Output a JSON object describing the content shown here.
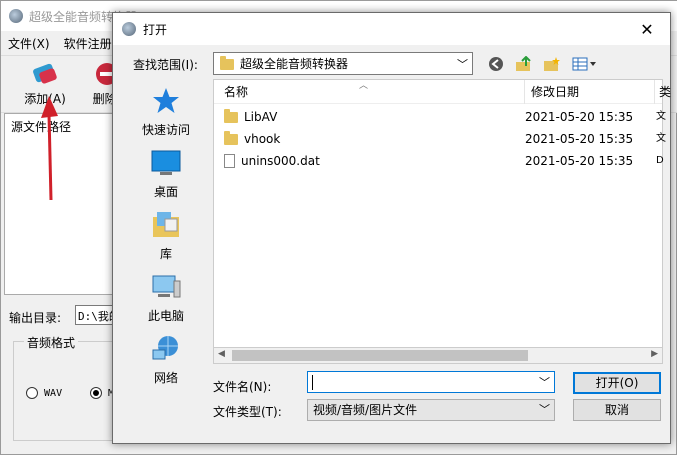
{
  "bg_app": {
    "title": "超级全能音频转换器",
    "menu": [
      "文件(X)",
      "软件注册"
    ],
    "toolbar": {
      "add_label": "添加(A)",
      "delete_label": "删除("
    },
    "list_header": "源文件路径",
    "output_label": "输出目录:",
    "output_value": "D:\\我的",
    "format_group": "音频格式",
    "format_options": [
      {
        "label": "WAV",
        "selected": false
      },
      {
        "label": "MI",
        "selected": true
      }
    ]
  },
  "dialog": {
    "title": "打开",
    "close": "✕",
    "look_in_label": "查找范围(I):",
    "look_in_value": "超级全能音频转换器",
    "places": [
      {
        "name": "快速访问",
        "icon": "quick-access-icon"
      },
      {
        "name": "桌面",
        "icon": "desktop-icon"
      },
      {
        "name": "库",
        "icon": "library-icon"
      },
      {
        "name": "此电脑",
        "icon": "this-pc-icon"
      },
      {
        "name": "网络",
        "icon": "network-icon"
      }
    ],
    "columns": {
      "name": "名称",
      "date": "修改日期",
      "extra": "类"
    },
    "files": [
      {
        "name": "LibAV",
        "date": "2021-05-20 15:35",
        "type": "folder",
        "extra": "文"
      },
      {
        "name": "vhook",
        "date": "2021-05-20 15:35",
        "type": "folder",
        "extra": "文"
      },
      {
        "name": "unins000.dat",
        "date": "2021-05-20 15:35",
        "type": "file",
        "extra": "D"
      }
    ],
    "filename_label": "文件名(N):",
    "filename_value": "",
    "filetype_label": "文件类型(T):",
    "filetype_value": "视频/音频/图片文件",
    "open_label": "打开(O)",
    "cancel_label": "取消"
  },
  "colors": {
    "accent": "#0078d7",
    "arrow": "#d0202a"
  }
}
